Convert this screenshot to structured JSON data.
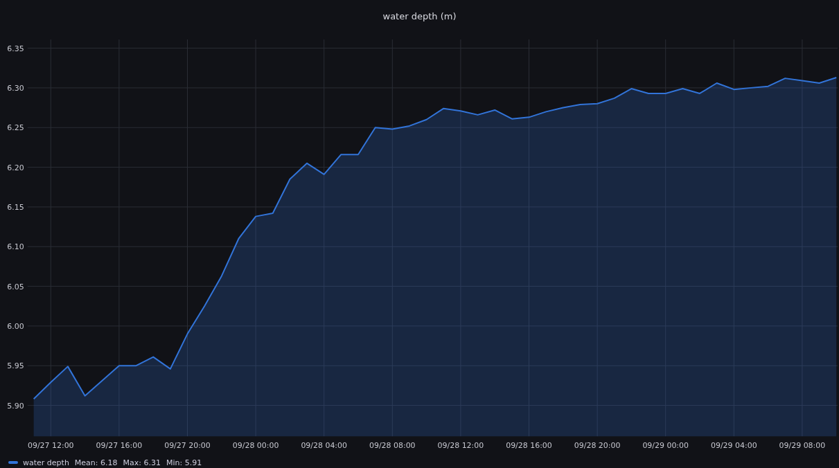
{
  "panel": {
    "title": "water depth (m)"
  },
  "chart_data": {
    "type": "area",
    "categories": [
      null,
      "09/27 12:00",
      null,
      null,
      null,
      "09/27 16:00",
      null,
      null,
      null,
      "09/27 20:00",
      null,
      null,
      null,
      "09/28 00:00",
      null,
      null,
      null,
      "09/28 04:00",
      null,
      null,
      null,
      "09/28 08:00",
      null,
      null,
      null,
      "09/28 12:00",
      null,
      null,
      null,
      "09/28 16:00",
      null,
      null,
      null,
      "09/28 20:00",
      null,
      null,
      null,
      "09/29 00:00",
      null,
      null,
      null,
      "09/29 04:00",
      null,
      null,
      null,
      "09/29 08:00",
      null,
      null
    ],
    "series": [
      {
        "name": "water depth",
        "color": "#3274d9",
        "values": [
          5.908,
          5.929,
          5.949,
          5.912,
          5.931,
          5.95,
          5.95,
          5.961,
          5.946,
          5.99,
          6.025,
          6.063,
          6.11,
          6.138,
          6.142,
          6.185,
          6.205,
          6.191,
          6.216,
          6.216,
          6.25,
          6.248,
          6.252,
          6.26,
          6.274,
          6.271,
          6.266,
          6.272,
          6.261,
          6.263,
          6.27,
          6.275,
          6.279,
          6.28,
          6.287,
          6.299,
          6.293,
          6.293,
          6.299,
          6.293,
          6.306,
          6.298,
          6.3,
          6.302,
          6.312,
          6.309,
          6.306,
          6.313
        ]
      }
    ],
    "grid": true,
    "ylim": [
      5.861,
      6.361
    ],
    "yticks": [
      {
        "value": 5.9,
        "label": "5.90"
      },
      {
        "value": 5.95,
        "label": "5.95"
      },
      {
        "value": 6.0,
        "label": "6.00"
      },
      {
        "value": 6.05,
        "label": "6.05"
      },
      {
        "value": 6.1,
        "label": "6.10"
      },
      {
        "value": 6.15,
        "label": "6.15"
      },
      {
        "value": 6.2,
        "label": "6.20"
      },
      {
        "value": 6.25,
        "label": "6.25"
      },
      {
        "value": 6.3,
        "label": "6.30"
      },
      {
        "value": 6.35,
        "label": "6.35"
      }
    ]
  },
  "legend": {
    "stats": [
      "Mean: 6.18",
      "Max: 6.31",
      "Min: 5.91"
    ]
  }
}
